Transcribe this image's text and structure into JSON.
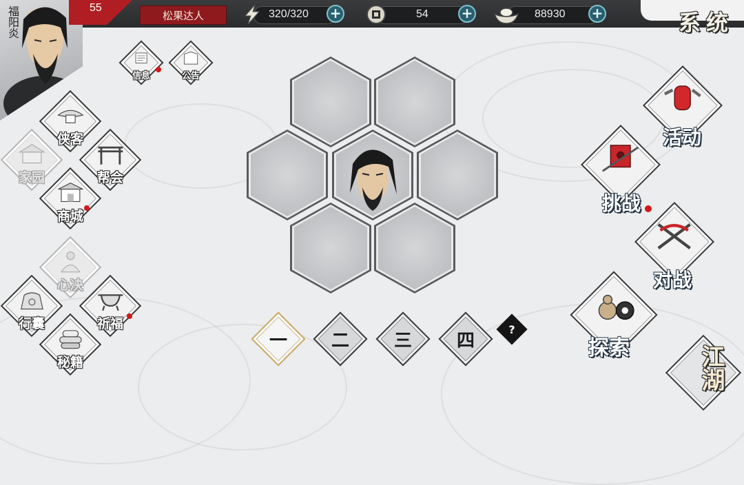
{
  "player": {
    "name": "福阳炎",
    "level": "55",
    "title": "松果达人"
  },
  "resources": {
    "stamina": {
      "icon": "lightning-icon",
      "value": "320/320"
    },
    "copper": {
      "icon": "coin-icon",
      "value": "54"
    },
    "silver": {
      "icon": "ingot-icon",
      "value": "88930"
    }
  },
  "system": {
    "label": "系统"
  },
  "top_buttons": [
    {
      "label": "信息",
      "badge": true
    },
    {
      "label": "公告",
      "badge": false
    }
  ],
  "left_menu": {
    "xiake": "侠客",
    "jiayuan": "家园",
    "banghui": "帮会",
    "shangcheng": "商城",
    "xinjue": "心决",
    "xingnang": "行囊",
    "qifu": "祈福",
    "miji": "秘籍"
  },
  "formation": {
    "tabs": [
      "一",
      "二",
      "三",
      "四"
    ],
    "active_tab": 0,
    "help": "?"
  },
  "right_menu": {
    "huodong": "活动",
    "tiaozhan": "挑战",
    "duizhan": "对战",
    "tansuo": "探索",
    "jianghu": "江湖"
  },
  "colors": {
    "accent_red": "#b01e23",
    "badge_red": "#d2191c",
    "plus_blue": "#7ec5d3"
  }
}
